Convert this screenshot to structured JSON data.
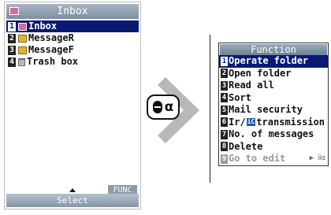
{
  "left_screen": {
    "title": "Inbox",
    "folders": [
      {
        "num": "1",
        "label": "Inbox",
        "icon": "inbox-icon",
        "selected": true
      },
      {
        "num": "2",
        "label": "MessageR",
        "icon": "folder-icon",
        "selected": false
      },
      {
        "num": "3",
        "label": "MessageF",
        "icon": "folder-icon",
        "selected": false
      },
      {
        "num": "4",
        "label": "Trash box",
        "icon": "trash-icon",
        "selected": false
      }
    ],
    "func_label": "FUNC",
    "select_label": "Select"
  },
  "menu": {
    "title": "Function",
    "items": [
      {
        "num": "1",
        "label": "Operate folder",
        "selected": true
      },
      {
        "num": "2",
        "label": "Open folder"
      },
      {
        "num": "3",
        "label": "Read all"
      },
      {
        "num": "4",
        "label": "Sort"
      },
      {
        "num": "5",
        "label": "Mail security"
      },
      {
        "num": "6",
        "label_pre": "Ir/",
        "badge": "iC",
        "label_post": " transmission"
      },
      {
        "num": "7",
        "label": "No. of messages"
      },
      {
        "num": "8",
        "label": "Delete"
      },
      {
        "num": "9",
        "label": "Go to edit",
        "disabled": true,
        "more": "▶ ⅱα"
      }
    ]
  },
  "key_icon": {
    "glyph": "α",
    "name": "function-key-icon"
  },
  "colors": {
    "highlight": "#0a1a74",
    "title_bar": "#7c8ea0",
    "inbox_icon": "#d96a96",
    "folder_icon": "#e0b530",
    "ic_badge": "#1f5ab0"
  }
}
